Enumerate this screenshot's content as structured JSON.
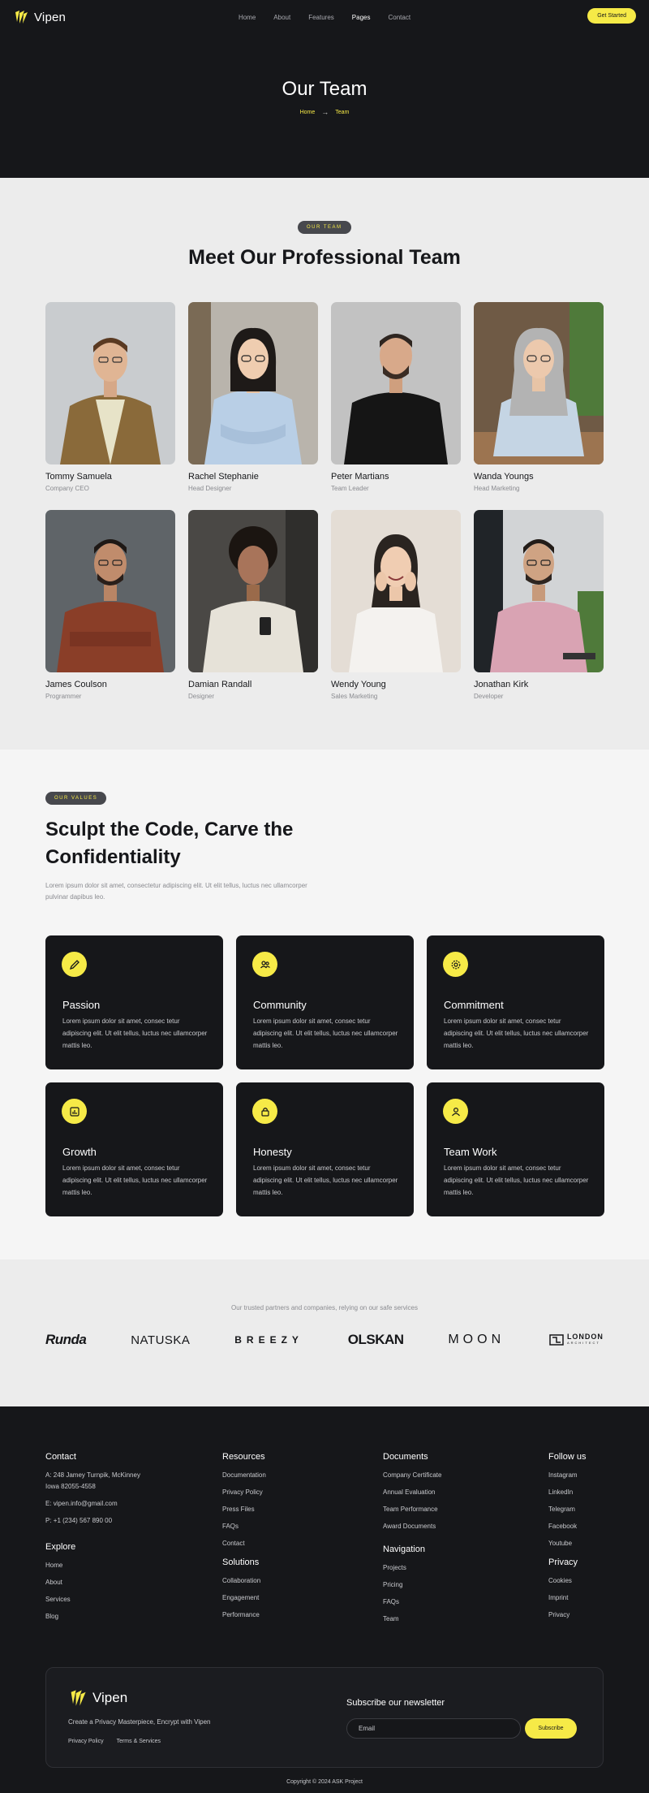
{
  "brand": {
    "name": "Vipen"
  },
  "nav": {
    "items": [
      "Home",
      "About",
      "Features",
      "Pages",
      "Contact"
    ],
    "active": "Pages",
    "cta": "Get Started"
  },
  "hero": {
    "title": "Our Team",
    "breadcrumb": [
      "Home",
      "Team"
    ]
  },
  "team": {
    "badge": "OUR TEAM",
    "title": "Meet Our Professional Team",
    "members": [
      {
        "name": "Tommy Samuela",
        "role": "Company CEO"
      },
      {
        "name": "Rachel Stephanie",
        "role": "Head Designer"
      },
      {
        "name": "Peter Martians",
        "role": "Team Leader"
      },
      {
        "name": "Wanda Youngs",
        "role": "Head Marketing"
      },
      {
        "name": "James Coulson",
        "role": "Programmer"
      },
      {
        "name": "Damian Randall",
        "role": "Designer"
      },
      {
        "name": "Wendy Young",
        "role": "Sales Marketing"
      },
      {
        "name": "Jonathan Kirk",
        "role": "Developer"
      }
    ]
  },
  "values": {
    "badge": "OUR VALUES",
    "title": "Sculpt the Code, Carve the Confidentiality",
    "text": "Lorem ipsum dolor sit amet, consectetur adipiscing elit. Ut elit tellus, luctus nec ullamcorper pulvinar dapibus leo.",
    "items": [
      {
        "name": "Passion",
        "icon": "pencil-icon",
        "desc": "Lorem ipsum dolor sit amet, consec tetur adipiscing elit. Ut elit tellus, luctus nec ullamcorper mattis leo."
      },
      {
        "name": "Community",
        "icon": "community-icon",
        "desc": "Lorem ipsum dolor sit amet, consec tetur adipiscing elit. Ut elit tellus, luctus nec ullamcorper mattis leo."
      },
      {
        "name": "Commitment",
        "icon": "gear-icon",
        "desc": "Lorem ipsum dolor sit amet, consec tetur adipiscing elit. Ut elit tellus, luctus nec ullamcorper mattis leo."
      },
      {
        "name": "Growth",
        "icon": "chart-icon",
        "desc": "Lorem ipsum dolor sit amet, consec tetur adipiscing elit. Ut elit tellus, luctus nec ullamcorper mattis leo."
      },
      {
        "name": "Honesty",
        "icon": "lock-icon",
        "desc": "Lorem ipsum dolor sit amet, consec tetur adipiscing elit. Ut elit tellus, luctus nec ullamcorper mattis leo."
      },
      {
        "name": "Team Work",
        "icon": "user-icon",
        "desc": "Lorem ipsum dolor sit amet, consec tetur adipiscing elit. Ut elit tellus, luctus nec ullamcorper mattis leo."
      }
    ]
  },
  "partners": {
    "text": "Our trusted partners and companies, relying on our safe services",
    "brands": [
      "Runda",
      "NATUSKA",
      "BREEZY",
      "OLSKAN",
      "MOON",
      "LONDON",
      "ARCHITECT"
    ]
  },
  "footer": {
    "contact": {
      "title": "Contact",
      "address_1": "A: 248 Jamey Turnpik, McKinney",
      "address_2": "Iowa 82055-4558",
      "email": "E: vipen.info@gmail.com",
      "phone": "P: +1 (234) 567 890 00"
    },
    "explore": {
      "title": "Explore",
      "links": [
        "Home",
        "About",
        "Services",
        "Blog"
      ]
    },
    "resources": {
      "title": "Resources",
      "links": [
        "Documentation",
        "Privacy Policy",
        "Press Files",
        "FAQs",
        "Contact"
      ]
    },
    "solutions": {
      "title": "Solutions",
      "links": [
        "Collaboration",
        "Engagement",
        "Performance"
      ]
    },
    "documents": {
      "title": "Documents",
      "links": [
        "Company Certificate",
        "Annual Evaluation",
        "Team Performance",
        "Award Documents"
      ]
    },
    "navigation": {
      "title": "Navigation",
      "links": [
        "Projects",
        "Pricing",
        "FAQs",
        "Team"
      ]
    },
    "follow": {
      "title": "Follow us",
      "links": [
        "Instagram",
        "LinkedIn",
        "Telegram",
        "Facebook",
        "Youtube"
      ]
    },
    "privacy": {
      "title": "Privacy",
      "links": [
        "Cookies",
        "Imprint",
        "Privacy"
      ]
    },
    "newsletter": {
      "tagline": "Create a Privacy Masterpiece, Encrypt with Vipen",
      "links": [
        "Privacy Policy",
        "Terms & Services"
      ],
      "title": "Subscribe our newsletter",
      "placeholder": "Email",
      "button": "Subscribe"
    },
    "copyright": "Copyright © 2024 ASK Project"
  },
  "colors": {
    "accent": "#f6ea47",
    "dark": "#16171a",
    "light": "#ececec"
  }
}
